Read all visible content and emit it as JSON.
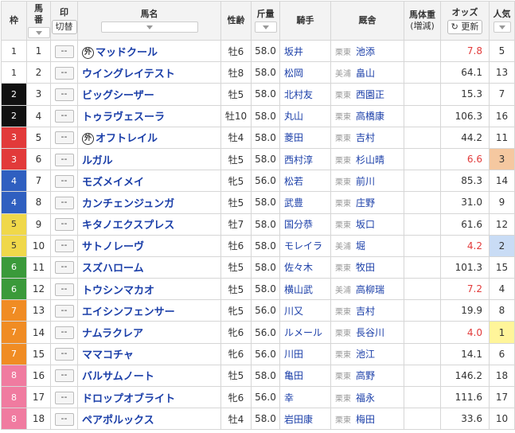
{
  "header": {
    "waku": "枠",
    "umaban": "馬番",
    "mark": "印",
    "switch_label": "切替",
    "horse": "馬名",
    "sexage": "性齢",
    "kinryo": "斤量",
    "jockey": "騎手",
    "stable": "厩舎",
    "weight": "馬体重",
    "weight_sub": "(増減)",
    "odds": "オッズ",
    "refresh_label": "更新",
    "pop": "人気"
  },
  "mark_placeholder": "--",
  "gai_label": "外",
  "rows": [
    {
      "waku": "1",
      "umaban": "1",
      "gai": true,
      "name": "マッドクール",
      "sexage": "牡6",
      "kin": "58.0",
      "jockey": "坂井",
      "region": "栗東",
      "trainer": "池添",
      "odds": "7.8",
      "hot": true,
      "pop": "5"
    },
    {
      "waku": "1",
      "umaban": "2",
      "gai": false,
      "name": "ウイングレイテスト",
      "sexage": "牡8",
      "kin": "58.0",
      "jockey": "松岡",
      "region": "美浦",
      "trainer": "畠山",
      "odds": "64.1",
      "hot": false,
      "pop": "13"
    },
    {
      "waku": "2",
      "umaban": "3",
      "gai": false,
      "name": "ビッグシーザー",
      "sexage": "牡5",
      "kin": "58.0",
      "jockey": "北村友",
      "region": "栗東",
      "trainer": "西園正",
      "odds": "15.3",
      "hot": false,
      "pop": "7"
    },
    {
      "waku": "2",
      "umaban": "4",
      "gai": false,
      "name": "トゥラヴェスーラ",
      "sexage": "牡10",
      "kin": "58.0",
      "jockey": "丸山",
      "region": "栗東",
      "trainer": "高橋康",
      "odds": "106.3",
      "hot": false,
      "pop": "16"
    },
    {
      "waku": "3",
      "umaban": "5",
      "gai": true,
      "name": "オフトレイル",
      "sexage": "牡4",
      "kin": "58.0",
      "jockey": "菱田",
      "region": "栗東",
      "trainer": "吉村",
      "odds": "44.2",
      "hot": false,
      "pop": "11"
    },
    {
      "waku": "3",
      "umaban": "6",
      "gai": false,
      "name": "ルガル",
      "sexage": "牡5",
      "kin": "58.0",
      "jockey": "西村淳",
      "region": "栗東",
      "trainer": "杉山晴",
      "odds": "6.6",
      "hot": true,
      "pop": "3"
    },
    {
      "waku": "4",
      "umaban": "7",
      "gai": false,
      "name": "モズメイメイ",
      "sexage": "牝5",
      "kin": "56.0",
      "jockey": "松若",
      "region": "栗東",
      "trainer": "前川",
      "odds": "85.3",
      "hot": false,
      "pop": "14"
    },
    {
      "waku": "4",
      "umaban": "8",
      "gai": false,
      "name": "カンチェンジュンガ",
      "sexage": "牡5",
      "kin": "58.0",
      "jockey": "武豊",
      "region": "栗東",
      "trainer": "庄野",
      "odds": "31.0",
      "hot": false,
      "pop": "9"
    },
    {
      "waku": "5",
      "umaban": "9",
      "gai": false,
      "name": "キタノエクスプレス",
      "sexage": "牡7",
      "kin": "58.0",
      "jockey": "国分恭",
      "region": "栗東",
      "trainer": "坂口",
      "odds": "61.6",
      "hot": false,
      "pop": "12"
    },
    {
      "waku": "5",
      "umaban": "10",
      "gai": false,
      "name": "サトノレーヴ",
      "sexage": "牡6",
      "kin": "58.0",
      "jockey": "モレイラ",
      "region": "美浦",
      "trainer": "堀",
      "odds": "4.2",
      "hot": true,
      "pop": "2"
    },
    {
      "waku": "6",
      "umaban": "11",
      "gai": false,
      "name": "スズハローム",
      "sexage": "牡5",
      "kin": "58.0",
      "jockey": "佐々木",
      "region": "栗東",
      "trainer": "牧田",
      "odds": "101.3",
      "hot": false,
      "pop": "15"
    },
    {
      "waku": "6",
      "umaban": "12",
      "gai": false,
      "name": "トウシンマカオ",
      "sexage": "牡5",
      "kin": "58.0",
      "jockey": "横山武",
      "region": "美浦",
      "trainer": "高柳瑞",
      "odds": "7.2",
      "hot": true,
      "pop": "4"
    },
    {
      "waku": "7",
      "umaban": "13",
      "gai": false,
      "name": "エイシンフェンサー",
      "sexage": "牝5",
      "kin": "56.0",
      "jockey": "川又",
      "region": "栗東",
      "trainer": "吉村",
      "odds": "19.9",
      "hot": false,
      "pop": "8"
    },
    {
      "waku": "7",
      "umaban": "14",
      "gai": false,
      "name": "ナムラクレア",
      "sexage": "牝6",
      "kin": "56.0",
      "jockey": "ルメール",
      "region": "栗東",
      "trainer": "長谷川",
      "odds": "4.0",
      "hot": true,
      "pop": "1"
    },
    {
      "waku": "7",
      "umaban": "15",
      "gai": false,
      "name": "ママコチャ",
      "sexage": "牝6",
      "kin": "56.0",
      "jockey": "川田",
      "region": "栗東",
      "trainer": "池江",
      "odds": "14.1",
      "hot": false,
      "pop": "6"
    },
    {
      "waku": "8",
      "umaban": "16",
      "gai": false,
      "name": "バルサムノート",
      "sexage": "牡5",
      "kin": "58.0",
      "jockey": "亀田",
      "region": "栗東",
      "trainer": "高野",
      "odds": "146.2",
      "hot": false,
      "pop": "18"
    },
    {
      "waku": "8",
      "umaban": "17",
      "gai": false,
      "name": "ドロップオブライト",
      "sexage": "牝6",
      "kin": "56.0",
      "jockey": "幸",
      "region": "栗東",
      "trainer": "福永",
      "odds": "111.6",
      "hot": false,
      "pop": "17"
    },
    {
      "waku": "8",
      "umaban": "18",
      "gai": false,
      "name": "ペアポルックス",
      "sexage": "牡4",
      "kin": "58.0",
      "jockey": "岩田康",
      "region": "栗東",
      "trainer": "梅田",
      "odds": "33.6",
      "hot": false,
      "pop": "10"
    }
  ]
}
